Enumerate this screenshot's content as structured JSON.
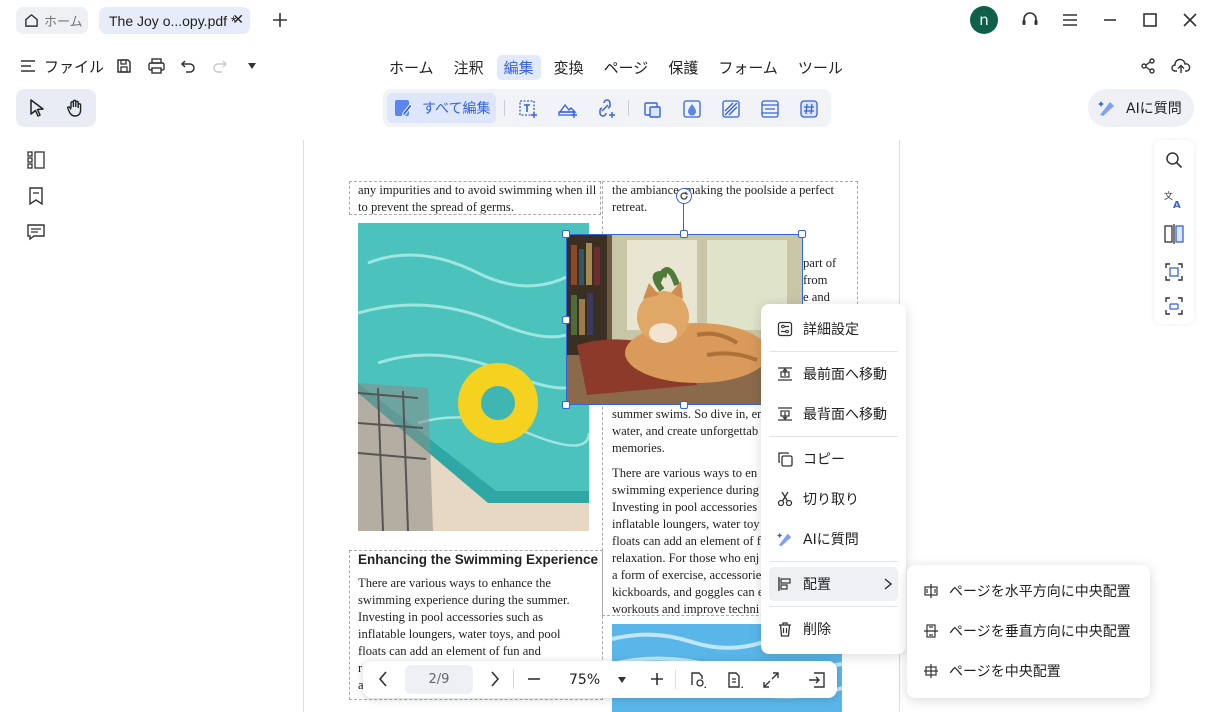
{
  "titlebar": {
    "home_tab": "ホーム",
    "doc_tab": "The Joy o...opy.pdf *",
    "avatar_letter": "n"
  },
  "menubar": {
    "file_label": "ファイル",
    "nav": [
      "ホーム",
      "注釈",
      "編集",
      "変換",
      "ページ",
      "保護",
      "フォーム",
      "ツール"
    ],
    "active_nav": "編集"
  },
  "toolbar": {
    "edit_all_label": "すべて編集",
    "ai_label": "AIに質問"
  },
  "document": {
    "left_top": "any impurities and to avoid swimming when ill to prevent the spread of germs.",
    "right_top": "the ambiance, making the poolside a perfect retreat.",
    "right_frag1": "part of",
    "right_frag2": "from",
    "right_frag3": "e and",
    "right_mid": "summer swims. So dive in, en water, and create unforgettab memories.",
    "right_para": "There are various ways to en swimming experience during Investing in pool accessories inflatable loungers, water toy floats can add an element of f relaxation. For those who enj a form of exercise, accessorie kickboards, and goggles can e workouts and improve techni",
    "heading": "Enhancing the Swimming Experience",
    "left_para": "There are various ways to enhance the swimming experience during the summer. Investing in pool accessories such as inflatable loungers, water toys, and pool floats can add an element of fun and",
    "left_frag1": "r",
    "left_frag2": "a"
  },
  "context_menu": {
    "details": "詳細設定",
    "bring_front": "最前面へ移動",
    "send_back": "最背面へ移動",
    "copy": "コピー",
    "cut": "切り取り",
    "ask_ai": "AIに質問",
    "arrange": "配置",
    "delete": "削除"
  },
  "submenu": {
    "center_h": "ページを水平方向に中央配置",
    "center_v": "ページを垂直方向に中央配置",
    "center_page": "ページを中央配置"
  },
  "bottombar": {
    "page_indicator": "2/9",
    "zoom": "75%"
  },
  "colors": {
    "accent": "#3563d9",
    "avatar": "#0f5f4a"
  }
}
